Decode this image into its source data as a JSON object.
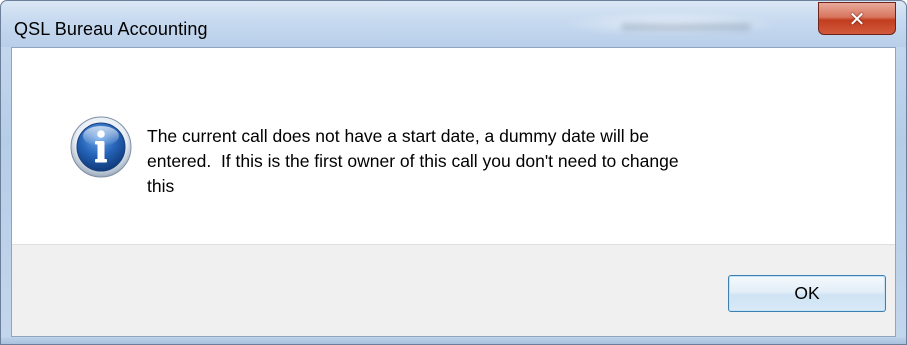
{
  "window": {
    "title": "QSL Bureau Accounting",
    "close_label": "✕"
  },
  "dialog": {
    "icon": "info-icon",
    "message": "The current call does not have a start date, a dummy date will be\nentered.  If this is the first owner of this call you don't need to change\nthis",
    "ok_label": "OK"
  },
  "colors": {
    "titlebar": "#c6d9ef",
    "close_button": "#c23d1f",
    "footer": "#f0f0f0",
    "ok_border": "#3c7fb1",
    "info_icon": "#1f5aa8"
  }
}
